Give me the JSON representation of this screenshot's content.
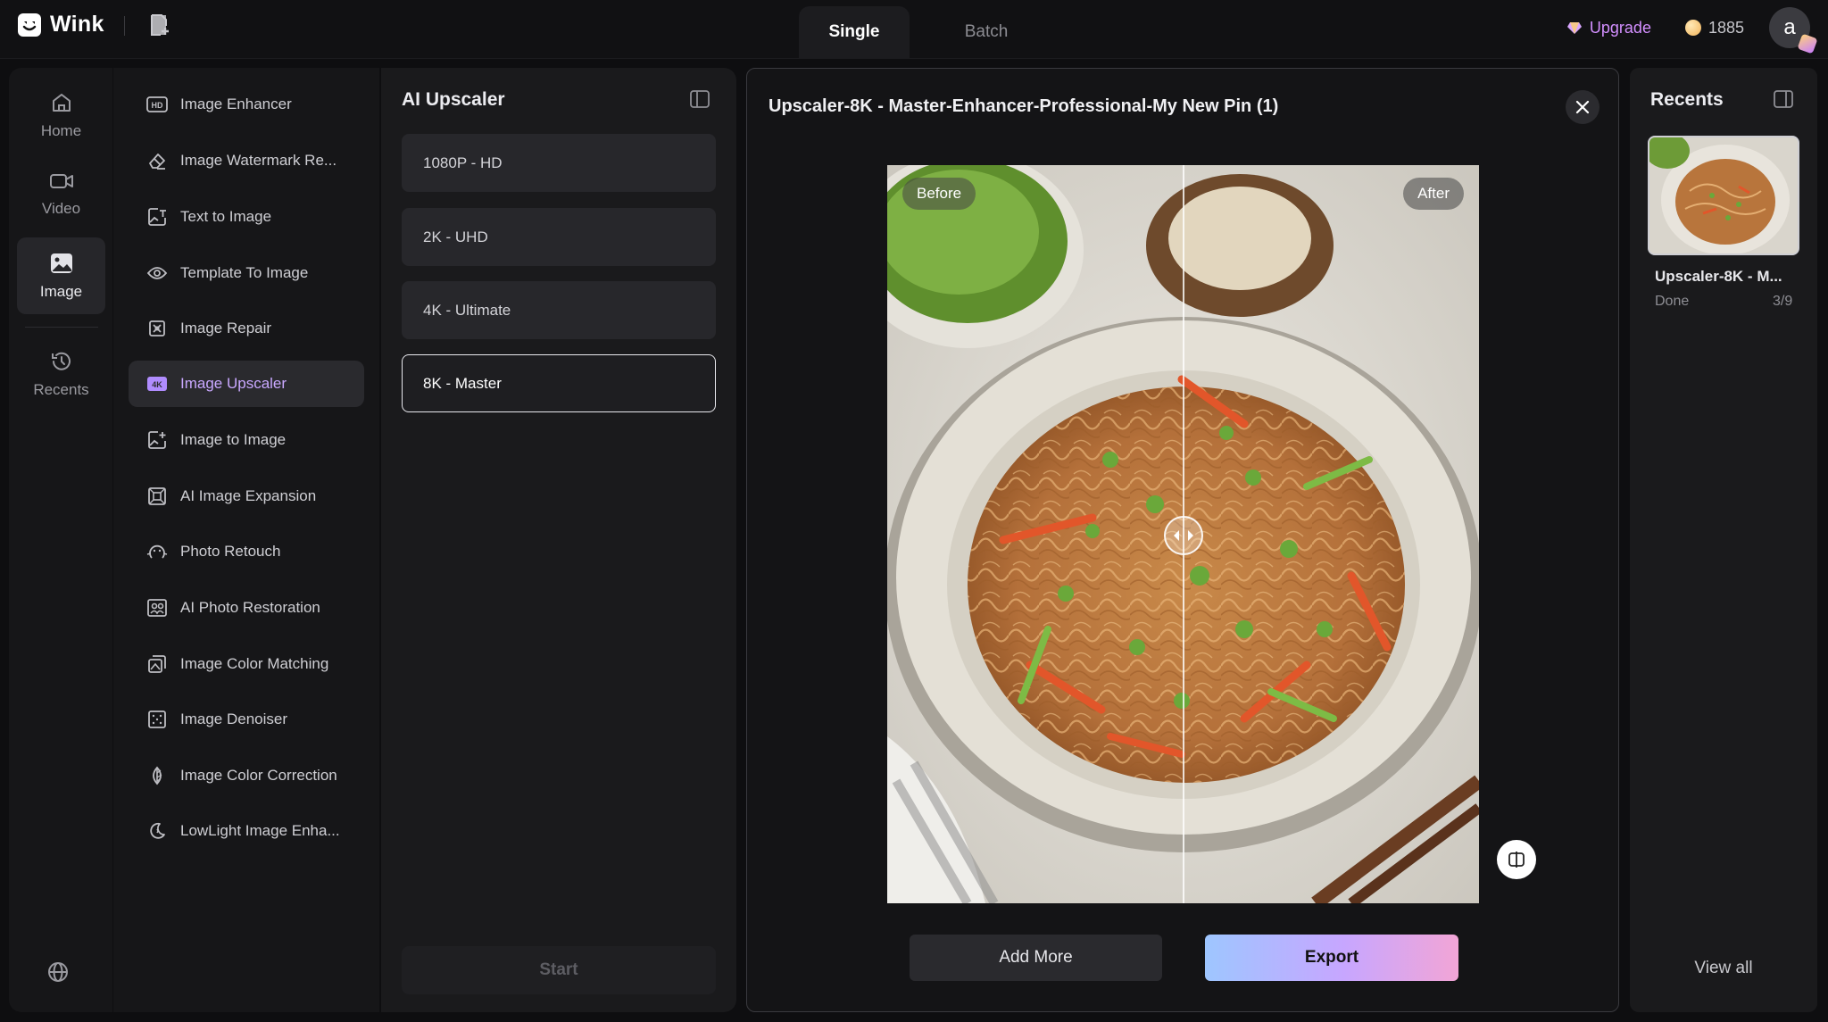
{
  "app": {
    "name": "Wink",
    "logo_icon": "wink-logo-icon",
    "doc_icon": "new-document-icon"
  },
  "mode_tabs": [
    {
      "label": "Single",
      "active": true
    },
    {
      "label": "Batch",
      "active": false
    }
  ],
  "header": {
    "upgrade_label": "Upgrade",
    "credits": "1885",
    "avatar_letter": "a"
  },
  "left_nav": [
    {
      "label": "Home",
      "icon": "home-icon",
      "active": false
    },
    {
      "label": "Video",
      "icon": "video-icon",
      "active": false
    },
    {
      "label": "Image",
      "icon": "image-icon",
      "active": true
    },
    {
      "label": "Recents",
      "icon": "history-icon",
      "active": false
    }
  ],
  "tools": [
    {
      "label": "Image Enhancer",
      "icon": "hd-icon",
      "active": false
    },
    {
      "label": "Image Watermark Re...",
      "icon": "eraser-icon",
      "active": false
    },
    {
      "label": "Text to Image",
      "icon": "text-image-icon",
      "active": false
    },
    {
      "label": "Template To Image",
      "icon": "template-icon",
      "active": false
    },
    {
      "label": "Image Repair",
      "icon": "repair-icon",
      "active": false
    },
    {
      "label": "Image Upscaler",
      "icon": "4k-icon",
      "active": true
    },
    {
      "label": "Image to Image",
      "icon": "image-to-image-icon",
      "active": false
    },
    {
      "label": "AI Image Expansion",
      "icon": "expand-icon",
      "active": false
    },
    {
      "label": "Photo Retouch",
      "icon": "retouch-icon",
      "active": false
    },
    {
      "label": "AI Photo Restoration",
      "icon": "restoration-icon",
      "active": false
    },
    {
      "label": "Image Color Matching",
      "icon": "color-match-icon",
      "active": false
    },
    {
      "label": "Image Denoiser",
      "icon": "denoise-icon",
      "active": false
    },
    {
      "label": "Image Color Correction",
      "icon": "color-correction-icon",
      "active": false
    },
    {
      "label": "LowLight Image Enha...",
      "icon": "lowlight-icon",
      "active": false
    }
  ],
  "options_panel": {
    "title": "AI Upscaler",
    "options": [
      {
        "label": "1080P - HD",
        "selected": false
      },
      {
        "label": "2K - UHD",
        "selected": false
      },
      {
        "label": "4K - Ultimate",
        "selected": false
      },
      {
        "label": "8K - Master",
        "selected": true
      }
    ],
    "start_label": "Start"
  },
  "preview": {
    "title": "Upscaler-8K - Master-Enhancer-Professional-My New Pin (1)",
    "before_label": "Before",
    "after_label": "After",
    "split_position": 0.5,
    "add_more_label": "Add More",
    "export_label": "Export"
  },
  "recents_panel": {
    "title": "Recents",
    "items": [
      {
        "name": "Upscaler-8K - M...",
        "status": "Done",
        "count": "3/9"
      }
    ],
    "view_all_label": "View all"
  },
  "colors": {
    "accent_purple": "#c9a8ff",
    "upgrade": "#d38fff",
    "export_gradient": [
      "#9ec6ff",
      "#c7a6ff",
      "#f2a5d6"
    ]
  }
}
